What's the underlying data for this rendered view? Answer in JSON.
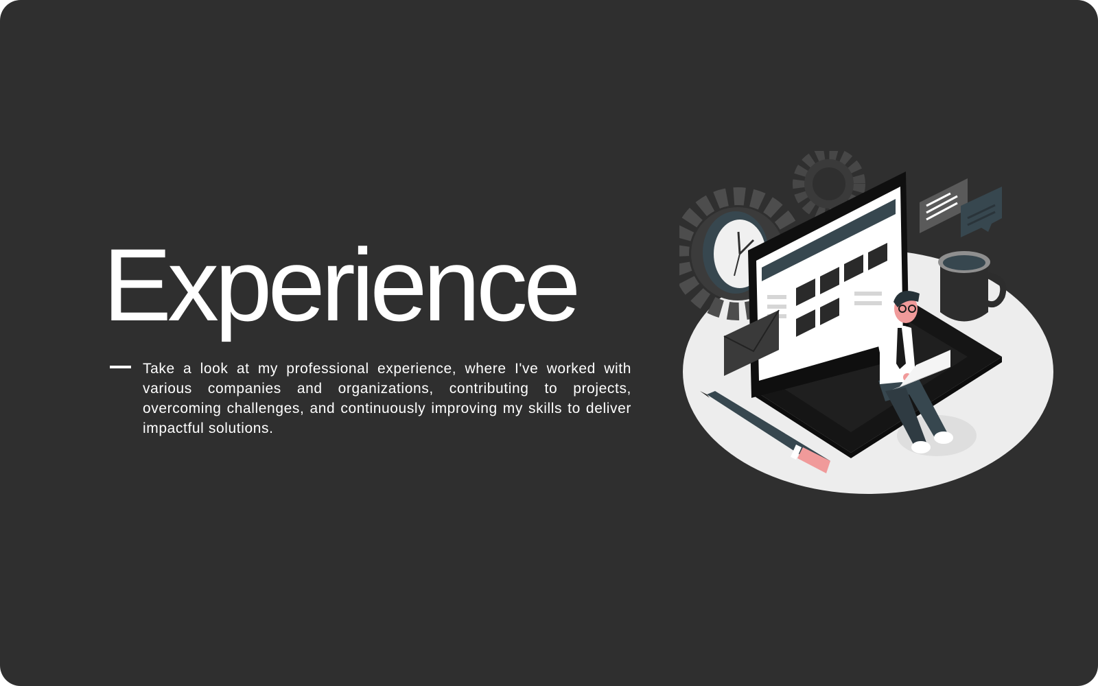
{
  "page": {
    "title": "Experience",
    "description": "Take a look at my professional experience, where I've worked with various companies and organizations, contributing to projects, overcoming challenges, and continuously improving my skills to deliver impactful solutions."
  },
  "colors": {
    "background": "#2f2f2f",
    "text": "#ffffff",
    "accent_slate": "#37474f",
    "accent_pink": "#f09a9a"
  },
  "illustration": {
    "subject": "person-working-on-laptop",
    "icons": [
      "gear-icon",
      "clock-icon",
      "laptop-icon",
      "envelope-icon",
      "chat-bubble-icon",
      "coffee-mug-icon",
      "pencil-icon"
    ]
  }
}
